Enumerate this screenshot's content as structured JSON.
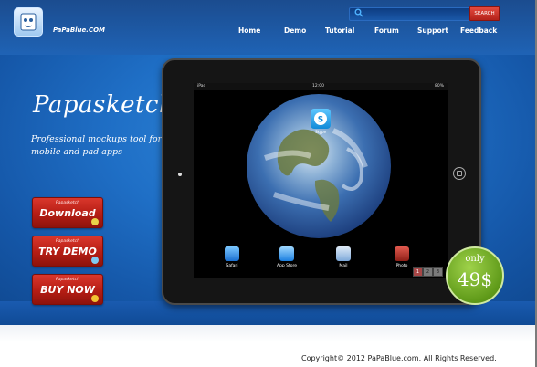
{
  "site": {
    "logo_text": "PaPaBlue.COM"
  },
  "search": {
    "placeholder": "",
    "button_label": "SEARCH"
  },
  "nav": {
    "items": [
      {
        "label": "Home"
      },
      {
        "label": "Demo"
      },
      {
        "label": "Tutorial"
      },
      {
        "label": "Forum"
      },
      {
        "label": "Support"
      },
      {
        "label": "Feedback"
      }
    ]
  },
  "hero": {
    "title": "Papasketch",
    "subtitle": "Professional mockups tool for mobile and pad apps"
  },
  "buttons": {
    "download": {
      "small": "Papasketch",
      "label": "Download"
    },
    "try_demo": {
      "small": "Papasketch",
      "label": "TRY DEMO"
    },
    "buy_now": {
      "small": "Papasketch",
      "label": "BUY NOW"
    }
  },
  "device": {
    "carrier": "iPad",
    "time": "12:00",
    "battery": "80%",
    "app_top": "Skype",
    "dock": [
      {
        "label": "Safari"
      },
      {
        "label": "App Store"
      },
      {
        "label": "Mail"
      },
      {
        "label": "Photo"
      }
    ],
    "pages": [
      "1",
      "2",
      "3"
    ]
  },
  "price": {
    "prefix": "only",
    "amount": "49$"
  },
  "footer": {
    "copyright": "Copyright© 2012 PaPaBlue.com. All Rights Reserved."
  },
  "colors": {
    "accent_red": "#c2281d",
    "hero_blue": "#1f6fc6",
    "price_green": "#6aa81f"
  }
}
